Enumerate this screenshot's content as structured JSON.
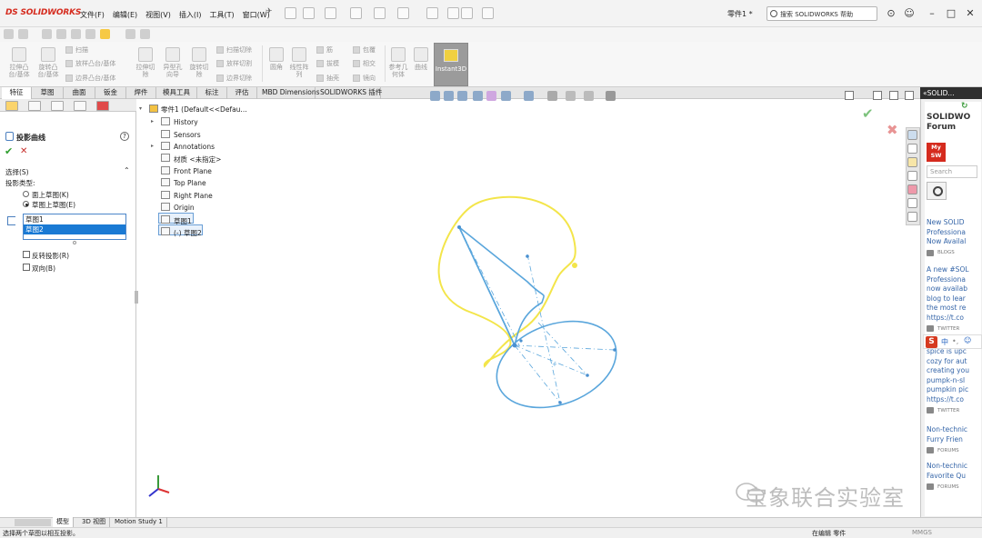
{
  "app": {
    "logo": "SOLIDWORKS",
    "logo_prefix": "DS",
    "document_name": "零件1 *",
    "search_placeholder": "搜索 SOLIDWORKS 帮助"
  },
  "menu": [
    "文件(F)",
    "编辑(E)",
    "视图(V)",
    "插入(I)",
    "工具(T)",
    "窗口(W)"
  ],
  "ribbon": {
    "large_buttons": [
      {
        "label": "拉伸凸\n台/基体"
      },
      {
        "label": "旋转凸\n台/基体"
      },
      {
        "label": "拉伸切\n除"
      },
      {
        "label": "异型孔\n向导"
      },
      {
        "label": "旋转切\n除"
      },
      {
        "label": "圆角"
      },
      {
        "label": "线性阵\n列"
      },
      {
        "label": "参考几\n何体"
      },
      {
        "label": "曲线"
      }
    ],
    "small_buttons": {
      "sweep": "扫描",
      "loft": "放样凸台/基体",
      "boundary": "边界凸台/基体",
      "swept_cut": "扫描切除",
      "lofted_cut": "放样切割",
      "boundary_cut": "边界切除",
      "rib": "筋",
      "draft": "拔模",
      "shell": "抽壳",
      "wrap": "包覆",
      "intersect": "相交",
      "mirror": "镜向"
    },
    "instant3d": "Instant3D"
  },
  "tabs": [
    "特征",
    "草图",
    "曲面",
    "钣金",
    "焊件",
    "模具工具",
    "标注",
    "评估",
    "MBD Dimensions",
    "SOLIDWORKS 插件"
  ],
  "property_manager": {
    "title": "投影曲线",
    "selection_header": "选择(S)",
    "projection_type_label": "投影类型:",
    "options": [
      {
        "label": "面上草图(K)",
        "selected": false
      },
      {
        "label": "草图上草图(E)",
        "selected": true
      }
    ],
    "selected_items": [
      "草图1",
      "草图2"
    ],
    "checkboxes": [
      {
        "label": "反转投影(R)",
        "checked": false
      },
      {
        "label": "双向(B)",
        "checked": false
      }
    ]
  },
  "feature_tree": {
    "root": "零件1 (Default<<Defau...",
    "items": [
      "History",
      "Sensors",
      "Annotations",
      "材质 <未指定>",
      "Front Plane",
      "Top Plane",
      "Right Plane",
      "Origin",
      "草图1",
      "(-) 草图2"
    ]
  },
  "task_pane": {
    "header": "SOLID...",
    "title_line1": "SOLIDWO",
    "title_line2": "Forum",
    "mysw_line1": "My",
    "mysw_line2": "SW",
    "search_placeholder": "Search",
    "news": [
      {
        "lines": [
          "New SOLID",
          "Professiona",
          "Now Availal"
        ],
        "source": "BLOGS"
      },
      {
        "lines": [
          "A new #SOL",
          "Professiona",
          "now availab",
          "blog to lear",
          "the most re",
          "https://t.co"
        ],
        "source": "TWITTER"
      },
      {
        "lines": [
          "spice is upc",
          "cozy for aut",
          "creating you",
          "pumpk-n-sl",
          "pumpkin pic",
          "https://t.co"
        ],
        "source": "TWITTER"
      },
      {
        "lines": [
          "Non-technic",
          "Furry Frien"
        ],
        "source": "FORUMS"
      },
      {
        "lines": [
          "Non-technic",
          "Favorite Qu"
        ],
        "source": "FORUMS"
      }
    ],
    "ime": "中"
  },
  "watermark": "宝象联合实验室",
  "bottom_tabs": [
    "模型",
    "3D 视图",
    "Motion Study 1"
  ],
  "status": {
    "message": "选择两个草图以相互投影。",
    "editing": "在编辑 零件",
    "units": "MMGS"
  },
  "colors": {
    "sketch1": "#f3e54a",
    "sketch2": "#5aa6dc",
    "selection_highlight": "#1a7ad4",
    "brand": "#d52b1e"
  }
}
